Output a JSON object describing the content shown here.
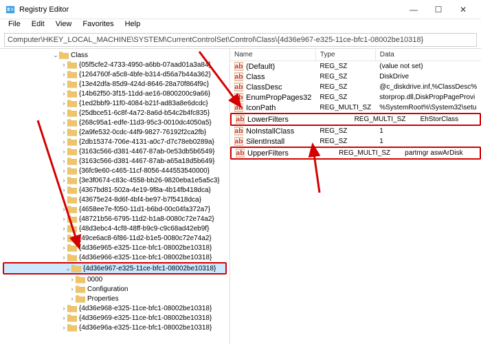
{
  "window": {
    "title": "Registry Editor",
    "controls": {
      "min": "—",
      "max": "☐",
      "close": "✕"
    }
  },
  "menu": [
    "File",
    "Edit",
    "View",
    "Favorites",
    "Help"
  ],
  "address": "Computer\\HKEY_LOCAL_MACHINE\\SYSTEM\\CurrentControlSet\\Control\\Class\\{4d36e967-e325-11ce-bfc1-08002be10318}",
  "tree": {
    "parent": "Class",
    "items": [
      "{05f5cfe2-4733-4950-a6bb-07aad01a3a84}",
      "{1264760f-a5c8-4bfe-b314-d56a7b44a362}",
      "{13e42dfa-85d9-424d-8646-28a70f864f9c}",
      "{14b62f50-3f15-11dd-ae16-0800200c9a66}",
      "{1ed2bbf9-11f0-4084-b21f-ad83a8e6dcdc}",
      "{25dbce51-6c8f-4a72-8a6d-b54c2b4fc835}",
      "{268c95a1-edfe-11d3-95c3-0010dc4050a5}",
      "{2a9fe532-0cdc-44f9-9827-76192f2ca2fb}",
      "{2db15374-706e-4131-a0c7-d7c78eb0289a}",
      "{3163c566-d381-4467-87ab-0e53db5b6549}",
      "{3163c566-d381-4467-87ab-a65a18d5b649}",
      "{36fc9e60-c465-11cf-8056-444553540000}",
      "{3e3f0674-c83c-4558-bb26-9820eba1e5a5c3}",
      "{4367bd81-502a-4e19-9f8a-4b14fb418dca}",
      "{43675e24-8d6f-4bf4-be97-b7f5418dca}",
      "{4658ee7e-f050-11d1-b6bd-00c04fa372a7}",
      "{48721b56-6795-11d2-b1a8-0080c72e74a2}",
      "{48d3ebc4-4cf8-48ff-b9c9-c9c68ad42eb9f}",
      "{49ce6ac8-6f86-11d2-b1e5-0080c72e74a2}",
      "{4d36e965-e325-11ce-bfc1-08002be10318}",
      "{4d36e966-e325-11ce-bfc1-08002be10318}"
    ],
    "selected": "{4d36e967-e325-11ce-bfc1-08002be10318}",
    "children": [
      "0000",
      "Configuration",
      "Properties"
    ],
    "after": [
      "{4d36e968-e325-11ce-bfc1-08002be10318}",
      "{4d36e969-e325-11ce-bfc1-08002be10318}",
      "{4d36e96a-e325-11ce-bfc1-08002be10318}"
    ]
  },
  "columns": {
    "name": "Name",
    "type": "Type",
    "data": "Data"
  },
  "values": [
    {
      "name": "(Default)",
      "type": "REG_SZ",
      "data": "(value not set)"
    },
    {
      "name": "Class",
      "type": "REG_SZ",
      "data": "DiskDrive"
    },
    {
      "name": "ClassDesc",
      "type": "REG_SZ",
      "data": "@c_diskdrive.inf,%ClassDesc%"
    },
    {
      "name": "EnumPropPages32",
      "type": "REG_SZ",
      "data": "storprop.dll,DiskPropPageProvi"
    },
    {
      "name": "IconPath",
      "type": "REG_MULTI_SZ",
      "data": "%SystemRoot%\\System32\\setu"
    },
    {
      "name": "LowerFilters",
      "type": "REG_MULTI_SZ",
      "data": "EhStorClass",
      "hl": true
    },
    {
      "name": "NoInstallClass",
      "type": "REG_SZ",
      "data": "1"
    },
    {
      "name": "SilentInstall",
      "type": "REG_SZ",
      "data": "1"
    },
    {
      "name": "UpperFilters",
      "type": "REG_MULTI_SZ",
      "data": "partmgr aswArDisk",
      "hl": true
    }
  ]
}
